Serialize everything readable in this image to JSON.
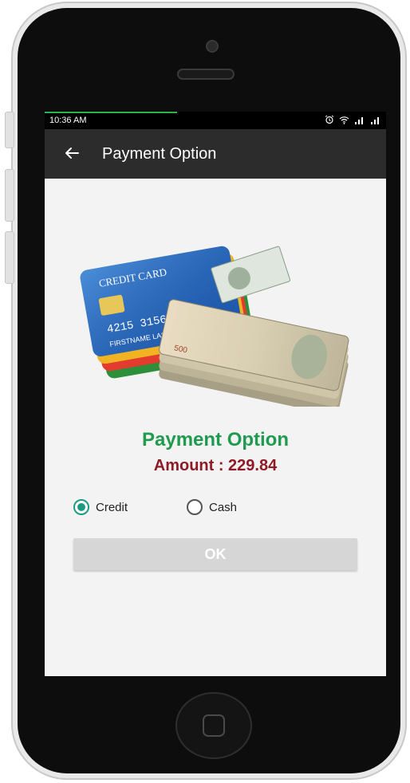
{
  "status_bar": {
    "time": "10:36 AM"
  },
  "toolbar": {
    "title": "Payment Option",
    "back_icon": "arrow-back-icon"
  },
  "hero_image": {
    "icon": "credit-card-and-cash-illustration"
  },
  "content": {
    "heading": "Payment Option",
    "amount_text": "Amount : 229.84"
  },
  "payment_methods": [
    {
      "label": "Credit",
      "selected": true
    },
    {
      "label": "Cash",
      "selected": false
    }
  ],
  "actions": {
    "ok_label": "OK"
  },
  "colors": {
    "heading": "#1e9b4e",
    "amount": "#8e1a26",
    "radio_accent": "#1c9b84",
    "toolbar": "#2c2c2c",
    "button": "#d6d6d6"
  }
}
